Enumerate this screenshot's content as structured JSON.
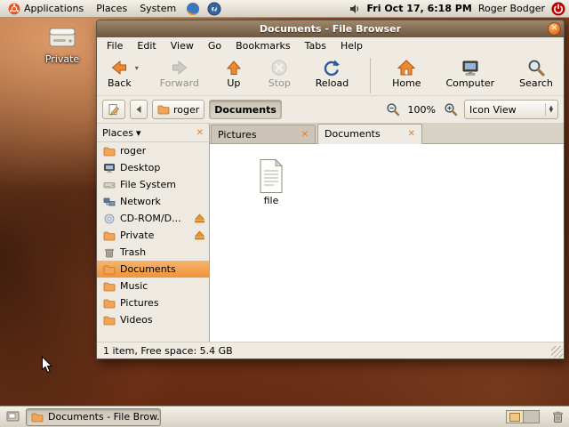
{
  "panel_top": {
    "menus": [
      "Applications",
      "Places",
      "System"
    ],
    "clock": "Fri Oct 17,  6:18 PM",
    "user": "Roger Bodger"
  },
  "desktop": {
    "private_icon_label": "Private"
  },
  "window": {
    "title": "Documents - File Browser",
    "menubar": [
      "File",
      "Edit",
      "View",
      "Go",
      "Bookmarks",
      "Tabs",
      "Help"
    ],
    "toolbar": {
      "back": "Back",
      "forward": "Forward",
      "up": "Up",
      "stop": "Stop",
      "reload": "Reload",
      "home": "Home",
      "computer": "Computer",
      "search": "Search"
    },
    "location_bar": {
      "path": [
        "roger",
        "Documents"
      ],
      "zoom_level": "100%",
      "view_mode": "Icon View"
    },
    "sidebar": {
      "header": "Places",
      "items": [
        {
          "label": "roger",
          "icon": "folder-icon"
        },
        {
          "label": "Desktop",
          "icon": "desktop-icon"
        },
        {
          "label": "File System",
          "icon": "drive-icon"
        },
        {
          "label": "Network",
          "icon": "network-icon"
        },
        {
          "label": "CD-ROM/D...",
          "icon": "cdrom-icon",
          "eject": true
        },
        {
          "label": "Private",
          "icon": "folder-icon",
          "eject": true
        },
        {
          "label": "Trash",
          "icon": "trash-icon"
        },
        {
          "label": "Documents",
          "icon": "folder-icon",
          "selected": true
        },
        {
          "label": "Music",
          "icon": "folder-icon"
        },
        {
          "label": "Pictures",
          "icon": "folder-icon"
        },
        {
          "label": "Videos",
          "icon": "folder-icon"
        }
      ]
    },
    "tabs": [
      {
        "label": "Pictures",
        "active": false
      },
      {
        "label": "Documents",
        "active": true
      }
    ],
    "files": [
      {
        "name": "file"
      }
    ],
    "statusbar": "1 item, Free space: 5.4 GB"
  },
  "panel_bottom": {
    "window_button": "Documents - File Brow..."
  },
  "icons": {
    "close_glyph": "✕",
    "dropdown_glyph": "▾",
    "combo_up": "▲",
    "combo_down": "▼",
    "help_glyph": "?"
  },
  "colors": {
    "accent_orange": "#E97A2B",
    "titlebar_brown": "#7C654D",
    "selection_orange": "#F09A42",
    "panel_bg": "#D7D1C4",
    "desktop_base": "#83421F"
  }
}
